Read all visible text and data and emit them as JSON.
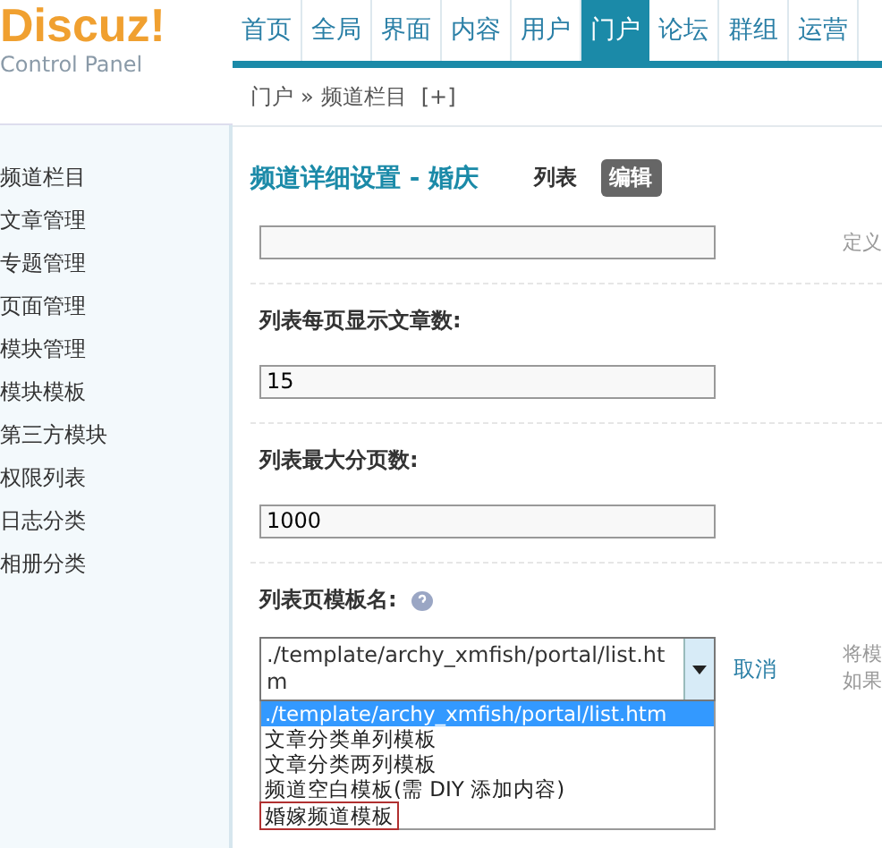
{
  "logo": {
    "name": "Discuz!",
    "subtitle": "Control Panel"
  },
  "nav": [
    {
      "label": "首页",
      "selected": false
    },
    {
      "label": "全局",
      "selected": false
    },
    {
      "label": "界面",
      "selected": false
    },
    {
      "label": "内容",
      "selected": false
    },
    {
      "label": "用户",
      "selected": false
    },
    {
      "label": "门户",
      "selected": true
    },
    {
      "label": "论坛",
      "selected": false
    },
    {
      "label": "群组",
      "selected": false
    },
    {
      "label": "运营",
      "selected": false
    }
  ],
  "breadcrumb": {
    "parts": [
      "门户",
      "»",
      "频道栏目"
    ],
    "add": "[+]"
  },
  "sidebar": {
    "items": [
      "频道栏目",
      "文章管理",
      "专题管理",
      "页面管理",
      "模块管理",
      "模块模板",
      "第三方模块",
      "权限列表",
      "日志分类",
      "相册分类"
    ]
  },
  "title": {
    "text": "频道详细设置 - 婚庆",
    "tabs": [
      {
        "label": "列表",
        "selected": false
      },
      {
        "label": "编辑",
        "selected": true
      }
    ]
  },
  "fields": [
    {
      "hint": "定义"
    },
    {
      "label": "列表每页显示文章数:",
      "value": "15"
    },
    {
      "label": "列表最大分页数:",
      "value": "1000"
    }
  ],
  "template": {
    "label": "列表页模板名:",
    "value": "./template/archy_xmfish/portal/list.htm",
    "cancel": "取消",
    "hint": [
      "将模",
      "如果"
    ],
    "options": [
      {
        "label": "./template/archy_xmfish/portal/list.htm",
        "selected": true,
        "highlighted": false
      },
      {
        "label": "文章分类单列模板",
        "selected": false,
        "highlighted": false
      },
      {
        "label": "文章分类两列模板",
        "selected": false,
        "highlighted": false
      },
      {
        "label": "频道空白模板(需 DIY 添加内容)",
        "selected": false,
        "highlighted": false
      },
      {
        "label": "婚嫁频道模板",
        "selected": false,
        "highlighted": true
      }
    ]
  }
}
